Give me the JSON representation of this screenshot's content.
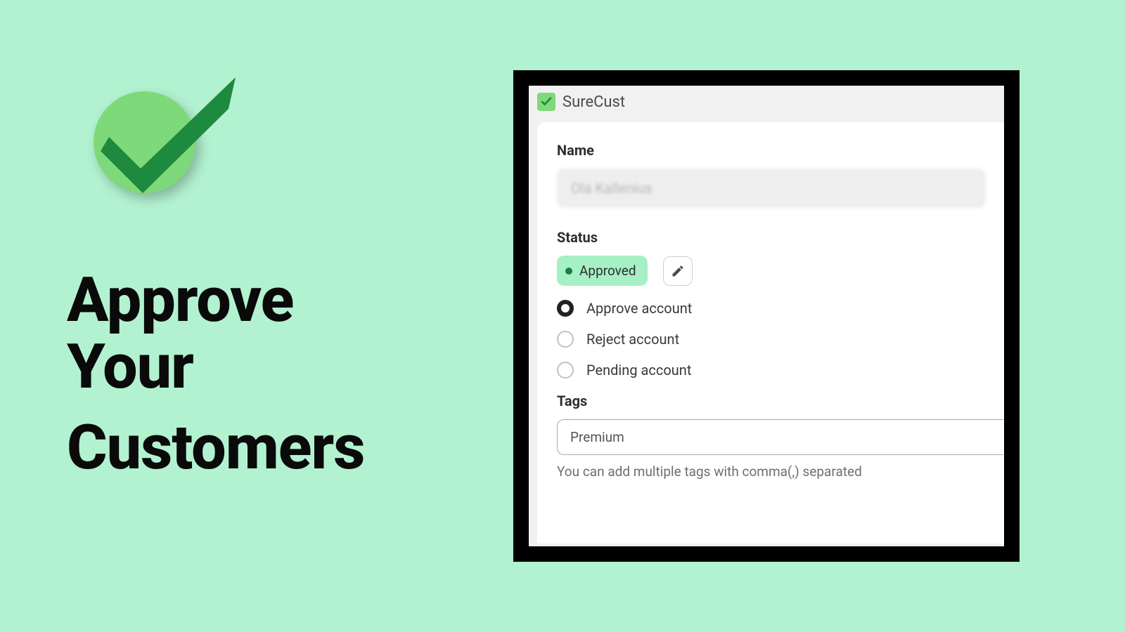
{
  "hero": {
    "line1": "Approve",
    "line2": "Your",
    "line3": "Customers"
  },
  "app": {
    "title": "SureCust"
  },
  "form": {
    "name_label": "Name",
    "name_value": "Ola Kallenius",
    "status_label": "Status",
    "status_badge": "Approved",
    "options": {
      "approve": "Approve account",
      "reject": "Reject account",
      "pending": "Pending account"
    },
    "tags_label": "Tags",
    "tags_value": "Premium",
    "tags_help": "You can add multiple tags with comma(,) separated"
  }
}
